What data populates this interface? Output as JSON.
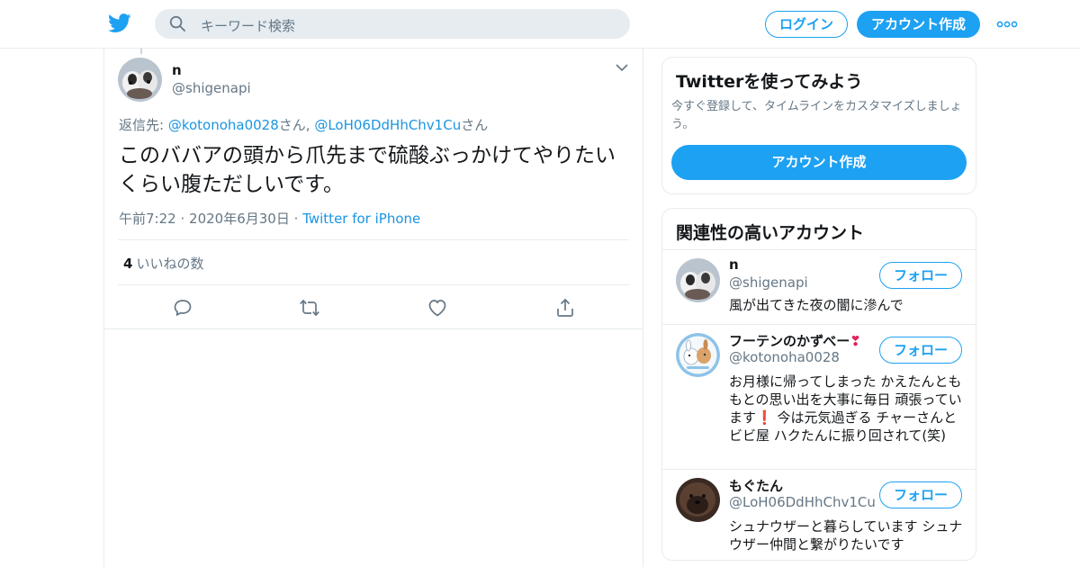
{
  "header": {
    "search_placeholder": "キーワード検索",
    "login_label": "ログイン",
    "signup_label": "アカウント作成",
    "brand_color": "#1da1f2"
  },
  "tweet": {
    "author_name": "n",
    "author_handle": "@shigenapi",
    "reply_prefix": "返信先: ",
    "reply_user1": "@kotonoha0028",
    "reply_san1": "さん, ",
    "reply_user2": "@LoH06DdHhChv1Cu",
    "reply_san2": "さん",
    "text": "このババアの頭から爪先まで硫酸ぶっかけてやりたいくらい腹ただしいです。",
    "time": "午前7:22",
    "date": "2020年6月30日",
    "source": "Twitter for iPhone",
    "likes_count": "4",
    "likes_label": "いいねの数",
    "actions": [
      "reply-icon",
      "retweet-icon",
      "like-icon",
      "share-icon"
    ]
  },
  "sidebar": {
    "signup_card": {
      "title": "Twitterを使ってみよう",
      "desc": "今すぐ登録して、タイムラインをカスタマイズしましょう。",
      "button_label": "アカウント作成"
    },
    "related_card": {
      "title": "関連性の高いアカウント",
      "follow_label": "フォロー",
      "accounts": [
        {
          "name": "n",
          "handle": "@shigenapi",
          "bio": "風が出てきた夜の闇に滲んで"
        },
        {
          "name": "フーテンのかずべー",
          "name_emoji": "❣",
          "handle": "@kotonoha0028",
          "bio_part1": "お月様に帰ってしまった かえたんとももとの思い出を大事に毎日 頑張っています",
          "bio_emoji": "❗",
          "bio_part2": " 今は元気過ぎる チャーさんとビビ屋 ハクたんに振り回されて(笑)"
        },
        {
          "name": "もぐたん",
          "handle": "@LoH06DdHhChv1Cu",
          "bio": "シュナウザーと暮らしています シュナウザー仲間と繋がりたいです"
        }
      ]
    }
  }
}
